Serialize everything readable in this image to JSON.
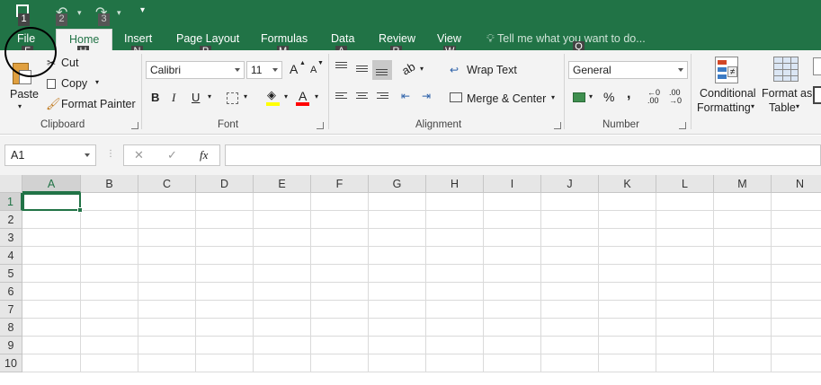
{
  "qat": {
    "keytips": [
      "1",
      "2",
      "3"
    ],
    "undo_icon": "undo-icon",
    "redo_icon": "redo-icon",
    "save_icon": "save-icon",
    "customize_icon": "customize-qat-icon"
  },
  "tabs": [
    {
      "label": "File",
      "keytip": "F"
    },
    {
      "label": "Home",
      "keytip": "H"
    },
    {
      "label": "Insert",
      "keytip": "N"
    },
    {
      "label": "Page Layout",
      "keytip": "P"
    },
    {
      "label": "Formulas",
      "keytip": "M"
    },
    {
      "label": "Data",
      "keytip": "A"
    },
    {
      "label": "Review",
      "keytip": "R"
    },
    {
      "label": "View",
      "keytip": "W"
    }
  ],
  "tellme": {
    "label": "Tell me what you want to do...",
    "keytip": "Q"
  },
  "clipboard": {
    "paste": "Paste",
    "cut": "Cut",
    "copy": "Copy",
    "format_painter": "Format Painter",
    "group_label": "Clipboard"
  },
  "font": {
    "family": "Calibri",
    "size": "11",
    "bold": "B",
    "italic": "I",
    "underline": "U",
    "grow": "A",
    "shrink": "A",
    "font_color": "A",
    "highlight_color": "#ffff00",
    "text_color": "#ff0000",
    "group_label": "Font"
  },
  "alignment": {
    "wrap_text": "Wrap Text",
    "merge_center": "Merge & Center",
    "group_label": "Alignment"
  },
  "number": {
    "format": "General",
    "percent": "%",
    "comma": ",",
    "group_label": "Number"
  },
  "styles": {
    "conditional_1": "Conditional",
    "conditional_2": "Formatting",
    "format_as_1": "Format as",
    "format_as_2": "Table"
  },
  "formula_bar": {
    "name_box": "A1",
    "cancel": "✕",
    "enter": "✓",
    "fx": "fx",
    "value": ""
  },
  "grid": {
    "columns": [
      "A",
      "B",
      "C",
      "D",
      "E",
      "F",
      "G",
      "H",
      "I",
      "J",
      "K",
      "L",
      "M",
      "N"
    ],
    "rows": [
      "1",
      "2",
      "3",
      "4",
      "5",
      "6",
      "7",
      "8",
      "9",
      "10"
    ],
    "active_cell": "A1"
  },
  "colors": {
    "brand": "#217346",
    "ribbon": "#f3f3f3"
  }
}
